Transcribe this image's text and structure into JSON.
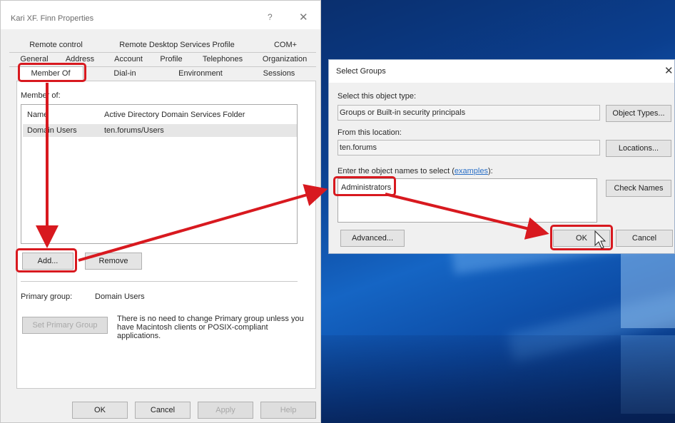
{
  "properties_dialog": {
    "title": "Kari XF. Finn Properties",
    "help_glyph": "?",
    "close_glyph": "✕",
    "tabs_row1": [
      "Remote control",
      "Remote Desktop Services Profile",
      "COM+"
    ],
    "tabs_row2": [
      "General",
      "Address",
      "Account",
      "Profile",
      "Telephones",
      "Organization"
    ],
    "tabs_row3": [
      "Member Of",
      "Dial-in",
      "Environment",
      "Sessions"
    ],
    "member_of_label": "Member of:",
    "list_headers": [
      "Name",
      "Active Directory Domain Services Folder"
    ],
    "list_rows": [
      {
        "name": "Domain Users",
        "folder": "ten.forums/Users"
      }
    ],
    "add_button": "Add...",
    "remove_button": "Remove",
    "primary_group_label": "Primary group:",
    "primary_group_value": "Domain Users",
    "set_primary_button": "Set Primary Group",
    "note": "There is no need to change Primary group unless you have Macintosh clients or POSIX-compliant applications.",
    "ok_button": "OK",
    "cancel_button": "Cancel",
    "apply_button": "Apply",
    "help_button": "Help"
  },
  "select_groups_dialog": {
    "title": "Select Groups",
    "close_glyph": "✕",
    "object_type_label": "Select this object type:",
    "object_type_value": "Groups or Built-in security principals",
    "object_types_button": "Object Types...",
    "location_label": "From this location:",
    "location_value": "ten.forums",
    "locations_button": "Locations...",
    "names_label": "Enter the object names to select (",
    "names_link": "examples",
    "names_label_end": "):",
    "names_value": "Administrators",
    "check_names_button": "Check Names",
    "advanced_button": "Advanced...",
    "ok_button": "OK",
    "cancel_button": "Cancel"
  },
  "colors": {
    "annotation_red": "#d8191f",
    "link_blue": "#2a6fc6",
    "desktop_blue": "#0b3f8f"
  },
  "icons": [
    "close-icon",
    "help-icon",
    "mouse-cursor-icon"
  ]
}
